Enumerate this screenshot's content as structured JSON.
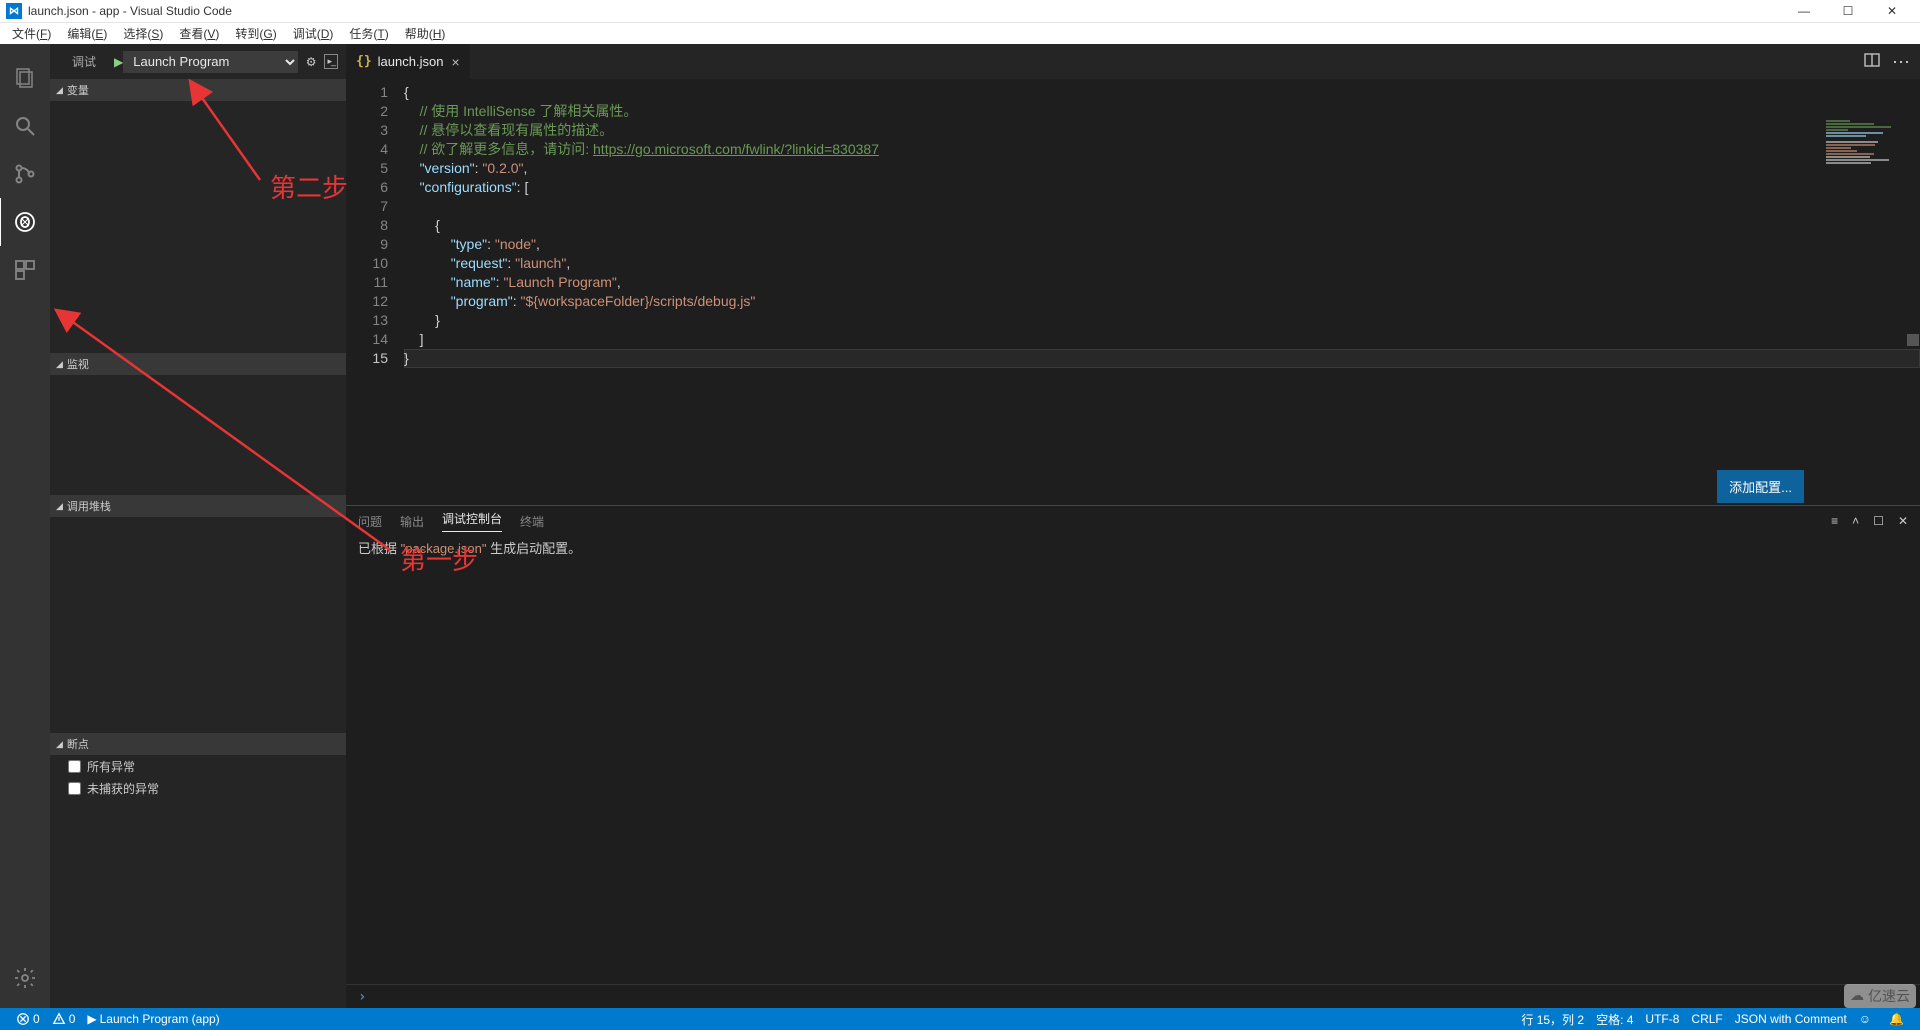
{
  "window": {
    "title": "launch.json - app - Visual Studio Code"
  },
  "menu": {
    "items": [
      "文件(F)",
      "编辑(E)",
      "选择(S)",
      "查看(V)",
      "转到(G)",
      "调试(D)",
      "任务(T)",
      "帮助(H)"
    ]
  },
  "debug": {
    "title": "调试",
    "config_selected": "Launch Program",
    "sections": {
      "variables": "变量",
      "watch": "监视",
      "callstack": "调用堆栈",
      "breakpoints": "断点"
    },
    "breakpoint_items": [
      "所有异常",
      "未捕获的异常"
    ]
  },
  "tab": {
    "filename": "launch.json"
  },
  "code": {
    "lines": [
      {
        "n": 1,
        "html": "<span class='tok-brace'>{</span>"
      },
      {
        "n": 2,
        "html": "    <span class='tok-cmt'>// 使用 IntelliSense 了解相关属性。</span>"
      },
      {
        "n": 3,
        "html": "    <span class='tok-cmt'>// 悬停以查看现有属性的描述。</span>"
      },
      {
        "n": 4,
        "html": "    <span class='tok-cmt'>// 欲了解更多信息，请访问: <span class='tok-link'>https://go.microsoft.com/fwlink/?linkid=830387</span></span>"
      },
      {
        "n": 5,
        "html": "    <span class='tok-key'>\"version\"</span><span class='tok-punc'>: </span><span class='tok-str'>\"0.2.0\"</span><span class='tok-punc'>,</span>"
      },
      {
        "n": 6,
        "html": "    <span class='tok-key'>\"configurations\"</span><span class='tok-punc'>: [</span>"
      },
      {
        "n": 7,
        "html": ""
      },
      {
        "n": 8,
        "html": "        <span class='tok-brace'>{</span>"
      },
      {
        "n": 9,
        "html": "            <span class='tok-key'>\"type\"</span><span class='tok-punc'>: </span><span class='tok-str'>\"node\"</span><span class='tok-punc'>,</span>"
      },
      {
        "n": 10,
        "html": "            <span class='tok-key'>\"request\"</span><span class='tok-punc'>: </span><span class='tok-str'>\"launch\"</span><span class='tok-punc'>,</span>"
      },
      {
        "n": 11,
        "html": "            <span class='tok-key'>\"name\"</span><span class='tok-punc'>: </span><span class='tok-str'>\"Launch Program\"</span><span class='tok-punc'>,</span>"
      },
      {
        "n": 12,
        "html": "            <span class='tok-key'>\"program\"</span><span class='tok-punc'>: </span><span class='tok-str'>\"${workspaceFolder}/scripts/debug.js\"</span>"
      },
      {
        "n": 13,
        "html": "        <span class='tok-brace'>}</span>"
      },
      {
        "n": 14,
        "html": "    <span class='tok-punc'>]</span>"
      },
      {
        "n": 15,
        "html": "<span class='tok-brace'>}</span>",
        "current": true
      }
    ]
  },
  "button": {
    "add_config": "添加配置..."
  },
  "panel": {
    "tabs": [
      "问题",
      "输出",
      "调试控制台",
      "终端"
    ],
    "active_index": 2,
    "message_pre": "已根据 ",
    "message_quoted": "\"package.json\"",
    "message_post": " 生成启动配置。"
  },
  "status": {
    "errors": "0",
    "warnings": "0",
    "launch": "Launch Program (app)",
    "ln_col": "行 15，列 2",
    "spaces": "空格: 4",
    "encoding": "UTF-8",
    "eol": "CRLF",
    "lang": "JSON with Comment"
  },
  "annotations": {
    "step1": "第一步",
    "step2": "第二步"
  },
  "watermark": "亿速云"
}
